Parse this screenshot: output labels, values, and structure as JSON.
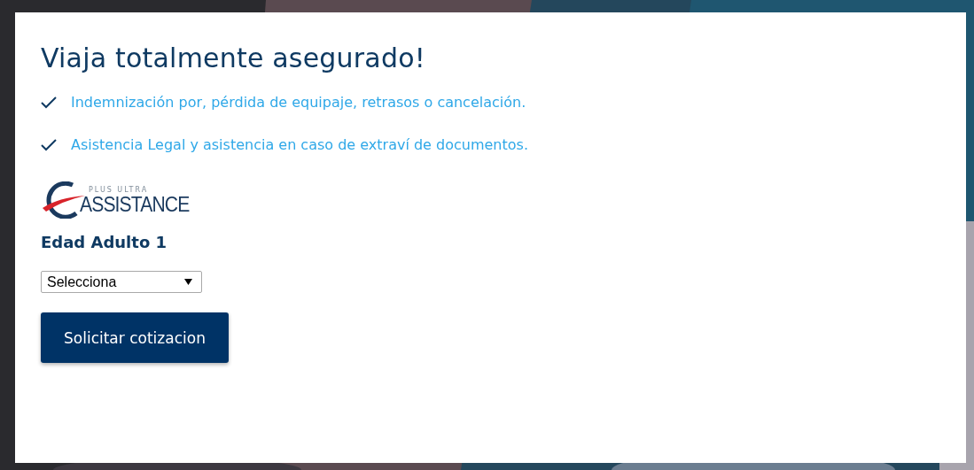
{
  "card": {
    "title": "Viaja totalmente asegurado!",
    "benefits": [
      {
        "text": "Indemnización por, pérdida de equipaje, retrasos o cancelación."
      },
      {
        "text": "Asistencia Legal y asistencia en caso de extraví de documentos."
      }
    ],
    "logo": {
      "top_text": "PLUS ULTRA",
      "main_text": "ASSISTANCE"
    },
    "age_label": "Edad Adulto 1",
    "age_select": {
      "value": "Selecciona"
    },
    "submit_button": "Solicitar cotizacion"
  }
}
